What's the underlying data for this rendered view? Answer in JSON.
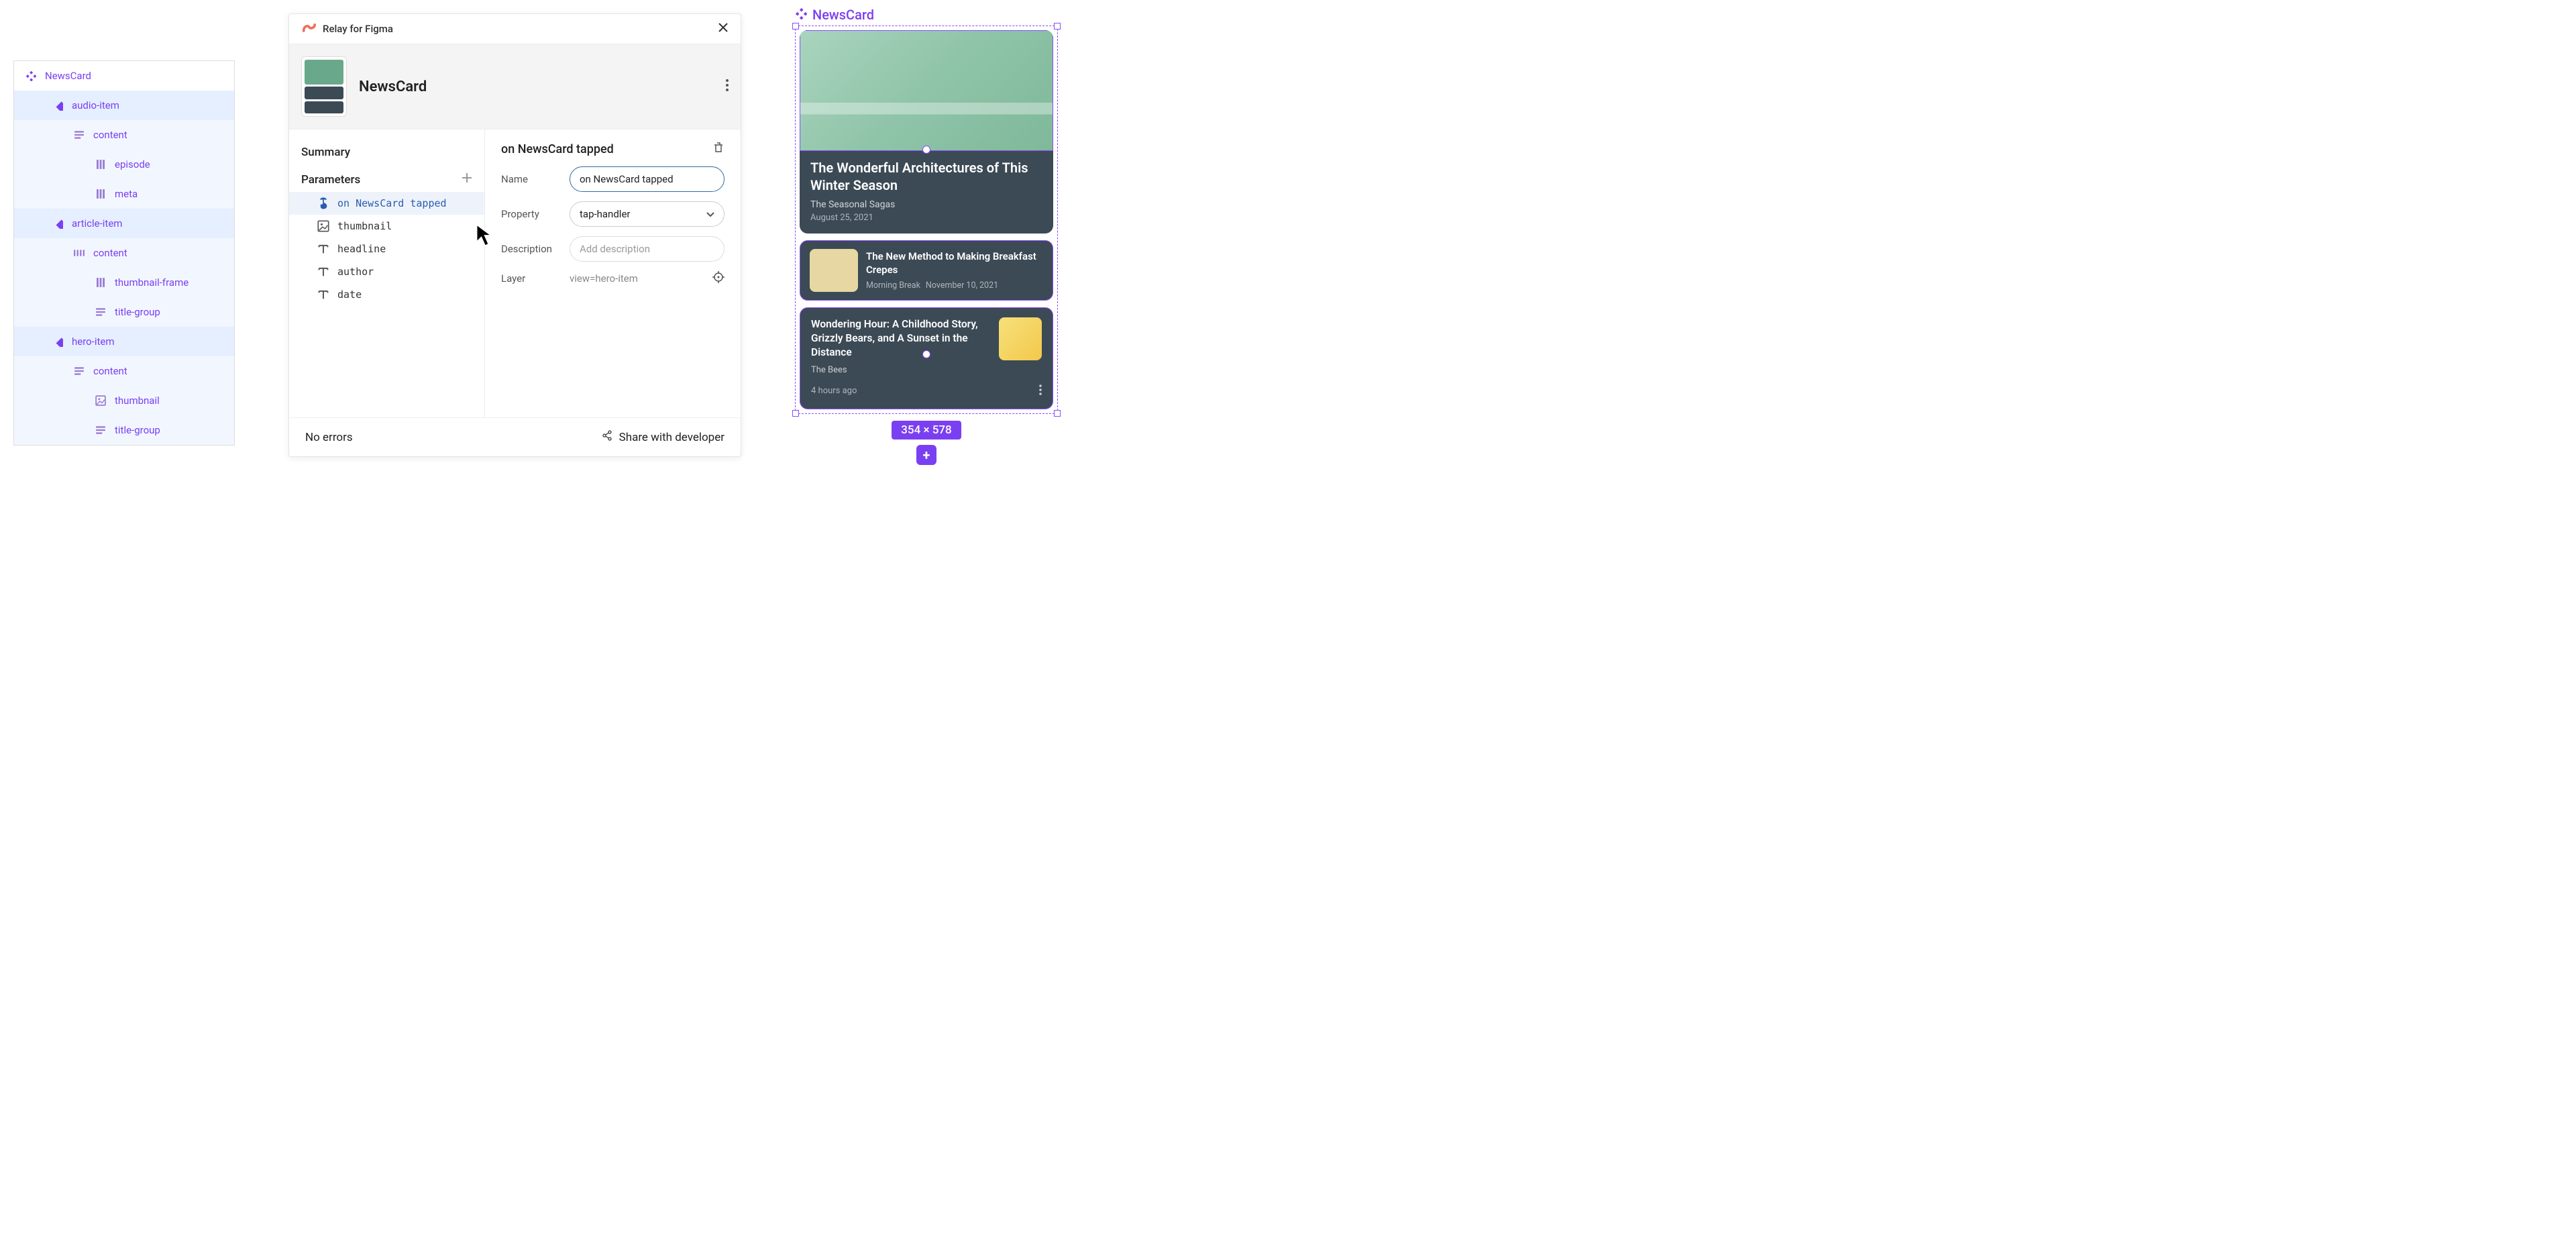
{
  "layer_tree": [
    {
      "depth": 0,
      "icon": "component-set",
      "label": "NewsCard",
      "bg": "none"
    },
    {
      "depth": 1,
      "icon": "variant",
      "label": "audio-item",
      "bg": "selected"
    },
    {
      "depth": 2,
      "icon": "lines",
      "label": "content",
      "bg": "hover"
    },
    {
      "depth": 3,
      "icon": "bars",
      "label": "episode",
      "bg": "hover"
    },
    {
      "depth": 3,
      "icon": "bars",
      "label": "meta",
      "bg": "hover"
    },
    {
      "depth": 1,
      "icon": "variant",
      "label": "article-item",
      "bg": "selected"
    },
    {
      "depth": 2,
      "icon": "bars-h",
      "label": "content",
      "bg": "hover"
    },
    {
      "depth": 3,
      "icon": "bars",
      "label": "thumbnail-frame",
      "bg": "hover"
    },
    {
      "depth": 3,
      "icon": "lines",
      "label": "title-group",
      "bg": "hover"
    },
    {
      "depth": 1,
      "icon": "variant",
      "label": "hero-item",
      "bg": "selected"
    },
    {
      "depth": 2,
      "icon": "lines",
      "label": "content",
      "bg": "hover"
    },
    {
      "depth": 3,
      "icon": "image",
      "label": "thumbnail",
      "bg": "hover"
    },
    {
      "depth": 3,
      "icon": "lines",
      "label": "title-group",
      "bg": "hover"
    }
  ],
  "relay": {
    "plugin_name": "Relay for Figma",
    "component_name": "NewsCard",
    "summary_title": "Summary",
    "parameters_title": "Parameters",
    "parameters": [
      {
        "icon": "tap",
        "name": "on NewsCard tapped",
        "selected": true
      },
      {
        "icon": "image",
        "name": "thumbnail",
        "selected": false
      },
      {
        "icon": "text",
        "name": "headline",
        "selected": false
      },
      {
        "icon": "text",
        "name": "author",
        "selected": false
      },
      {
        "icon": "text",
        "name": "date",
        "selected": false
      }
    ],
    "detail": {
      "title": "on NewsCard tapped",
      "name_label": "Name",
      "name_value": "on NewsCard tapped",
      "property_label": "Property",
      "property_value": "tap-handler",
      "description_label": "Description",
      "description_placeholder": "Add description",
      "layer_label": "Layer",
      "layer_value": "view=hero-item"
    },
    "footer": {
      "status": "No errors",
      "share": "Share with developer"
    }
  },
  "canvas": {
    "label": "NewsCard",
    "size_badge": "354 × 578",
    "hero": {
      "title": "The Wonderful Architectures of This Winter Season",
      "author": "The Seasonal Sagas",
      "date": "August 25, 2021"
    },
    "article": {
      "title": "The New Method to Making Breakfast Crepes",
      "author": "Morning Break",
      "date": "November 10, 2021"
    },
    "audio": {
      "title": "Wondering Hour: A Childhood Story, Grizzly Bears, and A Sunset in the Distance",
      "author": "The Bees",
      "time": "4 hours ago"
    }
  }
}
